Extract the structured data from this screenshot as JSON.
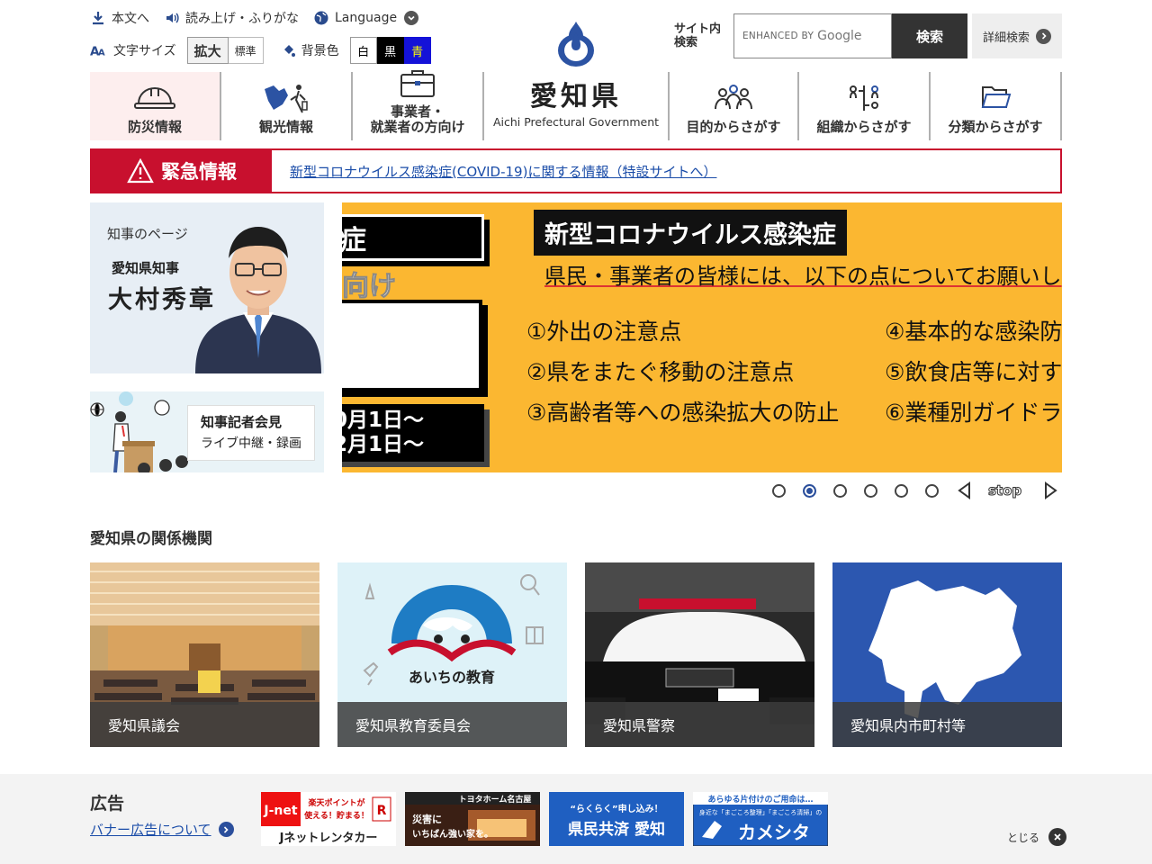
{
  "util": {
    "skip": "本文へ",
    "read": "読み上げ・ふりがな",
    "language": "Language",
    "font_size": "文字サイズ",
    "size_large": "拡大",
    "size_standard": "標準",
    "bg_color": "背景色",
    "bg_white": "白",
    "bg_black": "黒",
    "bg_blue": "青"
  },
  "logo": {
    "ja": "愛知県",
    "en": "Aichi Prefectural Government"
  },
  "search": {
    "label_line1": "サイト内",
    "label_line2": "検索",
    "enhanced": "ENHANCED BY",
    "google": "Google",
    "button": "検索",
    "advanced": "詳細検索"
  },
  "nav": [
    {
      "label": "防災情報",
      "icon": "helmet-icon"
    },
    {
      "label": "観光情報",
      "icon": "tourism-icon"
    },
    {
      "label_line1": "事業者・",
      "label_line2": "就業者の方向け",
      "icon": "briefcase-icon"
    },
    {
      "label": "目的からさがす",
      "icon": "people-icon"
    },
    {
      "label": "組織からさがす",
      "icon": "org-chart-icon"
    },
    {
      "label": "分類からさがす",
      "icon": "folder-icon"
    }
  ],
  "emergency": {
    "label": "緊急情報",
    "link": "新型コロナウイルス感染症(COVID-19)に関する情報（特設サイトへ）"
  },
  "governor": {
    "page": "知事のページ",
    "title": "愛知県知事",
    "name": "大村秀章"
  },
  "press": {
    "title": "知事記者会見",
    "sub": "ライブ中継・録画"
  },
  "slide": {
    "left_top": "症",
    "left_mid": "向け",
    "date1": "0月1日～",
    "date2": "2月1日～",
    "title": "新型コロナウイルス感染症",
    "request": "県民・事業者の皆様には、以下の点についてお願いし",
    "points": [
      "①外出の注意点",
      "②県をまたぐ移動の注意点",
      "③高齢者等への感染拡大の防止",
      "④基本的な感染防",
      "⑤飲食店等に対す",
      "⑥業種別ガイドラ"
    ]
  },
  "slider_controls": {
    "stop": "stop",
    "active_index": 1,
    "count": 6
  },
  "related": {
    "title": "愛知県の関係機関",
    "items": [
      {
        "label": "愛知県議会"
      },
      {
        "label": "愛知県教育委員会",
        "logo_text": "あいちの教育"
      },
      {
        "label": "愛知県警察"
      },
      {
        "label": "愛知県内市町村等"
      }
    ]
  },
  "ad": {
    "title": "広告",
    "about": "バナー広告について",
    "close": "とじる",
    "banners": [
      {
        "name": "Jネットレンタカー",
        "line1": "楽天ポイントが",
        "line2": "使える！貯まる！"
      },
      {
        "name": "トヨタホーム名古屋",
        "line1": "災害に",
        "line2": "いちばん強い家を。"
      },
      {
        "name": "県民共済 愛知",
        "line1": "“らくらく”申し込み！"
      },
      {
        "name": "カメシタ",
        "line1": "あらゆる片付けのご用命は…",
        "line2": "身近な「まごころ整理」「まごころ清掃」の"
      }
    ]
  },
  "colors": {
    "emergency": "#c8102e",
    "slide_bg": "#fbb731",
    "link": "#1a4ca8",
    "accent": "#2b4f9c"
  }
}
